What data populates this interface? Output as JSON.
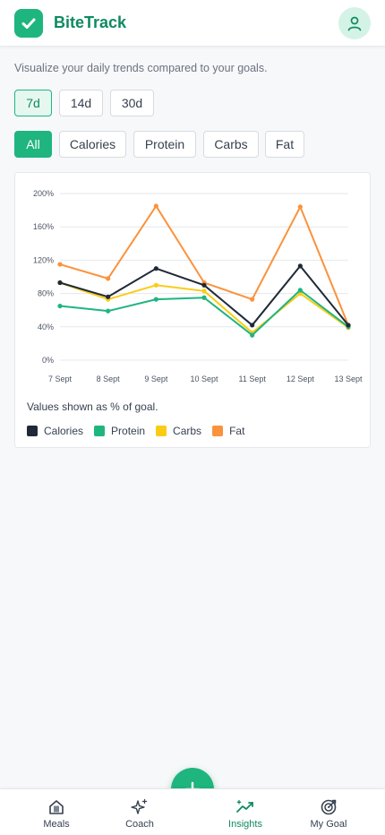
{
  "app": {
    "name": "BiteTrack",
    "logo_icon": "checkmark-icon",
    "avatar_icon": "user-icon"
  },
  "subtitle": "Visualize your daily trends compared to your goals.",
  "ranges": [
    {
      "label": "7d",
      "active": true
    },
    {
      "label": "14d",
      "active": false
    },
    {
      "label": "30d",
      "active": false
    }
  ],
  "metrics": [
    {
      "label": "All",
      "active": true
    },
    {
      "label": "Calories",
      "active": false
    },
    {
      "label": "Protein",
      "active": false
    },
    {
      "label": "Carbs",
      "active": false
    },
    {
      "label": "Fat",
      "active": false
    }
  ],
  "chart_data": {
    "type": "line",
    "x": [
      "7 Sept",
      "8 Sept",
      "9 Sept",
      "10 Sept",
      "11 Sept",
      "12 Sept",
      "13 Sept"
    ],
    "y_ticks": [
      "0%",
      "40%",
      "80%",
      "120%",
      "160%",
      "200%"
    ],
    "ylim": [
      0,
      200
    ],
    "grid": true,
    "legend_position": "bottom-left",
    "series": [
      {
        "name": "Calories",
        "color": "#1f2937",
        "values": [
          93,
          76,
          110,
          90,
          42,
          113,
          42
        ]
      },
      {
        "name": "Protein",
        "color": "#1fb57f",
        "values": [
          65,
          59,
          73,
          75,
          30,
          84,
          40
        ]
      },
      {
        "name": "Carbs",
        "color": "#facc15",
        "values": [
          93,
          73,
          90,
          83,
          33,
          80,
          39
        ]
      },
      {
        "name": "Fat",
        "color": "#fb923c",
        "values": [
          115,
          98,
          185,
          93,
          73,
          184,
          42
        ]
      }
    ]
  },
  "chart_note": "Values shown as % of goal.",
  "bottom_nav": [
    {
      "label": "Meals",
      "icon": "meals-icon",
      "active": false
    },
    {
      "label": "Coach",
      "icon": "sparkles-icon",
      "active": false
    },
    {
      "label": "Insights",
      "icon": "trend-icon",
      "active": true
    },
    {
      "label": "My Goal",
      "icon": "target-icon",
      "active": false
    }
  ],
  "fab_icon": "plus-icon",
  "colors": {
    "brand": "#1fb57f",
    "brand_dark": "#0f8a5f"
  }
}
